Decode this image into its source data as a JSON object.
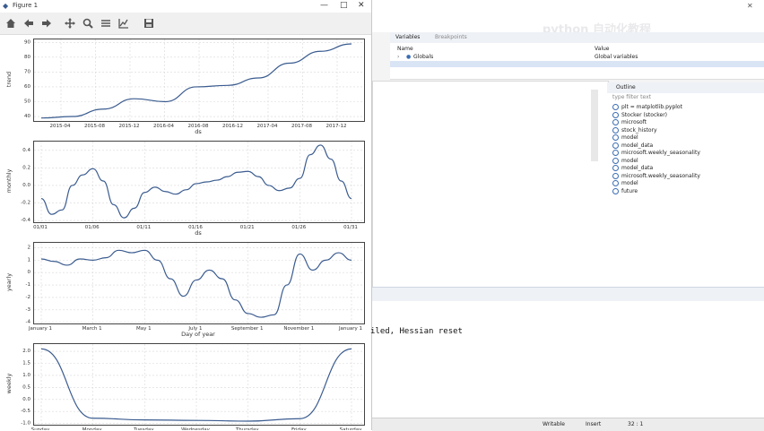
{
  "window": {
    "title": "Figure 1",
    "min": "—",
    "max": "□",
    "close": "✕"
  },
  "ide": {
    "watermark": "python 自动化教程 ",
    "variables_tab": "Variables",
    "breakpoints_tab": "Breakpoints",
    "var_col_name": "Name",
    "var_col_value": "Value",
    "globals_name": "Globals",
    "globals_value": "Global variables",
    "outline_tab": "Outline",
    "outline_filter": "type filter text",
    "outline_items": [
      "plt = matplotlib.pyplot",
      "Stocker (stocker)",
      "microsoft",
      "stock_history",
      "model",
      "model_data",
      "microsoft.weekly_seasonality",
      "model",
      "model_data",
      "microsoft.weekly_seasonality",
      "model",
      "future"
    ],
    "console_text": "iled, Hessian reset",
    "status_writable": "Writable",
    "status_insert": "Insert",
    "status_pos": "32 : 1"
  },
  "chart_data": [
    {
      "type": "line",
      "title": "",
      "xlabel": "ds",
      "ylabel": "trend",
      "grid": true,
      "x": [
        "2015-02",
        "2015-04",
        "2015-08",
        "2015-12",
        "2016-04",
        "2016-08",
        "2016-12",
        "2017-04",
        "2017-08",
        "2017-12",
        "2018-01"
      ],
      "series": [
        {
          "values": [
            39,
            40,
            45,
            52,
            50,
            60,
            61,
            66,
            76,
            84,
            89
          ]
        }
      ],
      "xticks": [
        "2015-04",
        "2015-08",
        "2015-12",
        "2016-04",
        "2016-08",
        "2016-12",
        "2017-04",
        "2017-08",
        "2017-12"
      ],
      "yticks": [
        "40",
        "50",
        "60",
        "70",
        "80",
        "90"
      ],
      "ylim": [
        37,
        92
      ]
    },
    {
      "type": "line",
      "title": "",
      "xlabel": "ds",
      "ylabel": "monthly",
      "grid": true,
      "x": [
        1,
        2,
        3,
        4,
        5,
        6,
        7,
        8,
        9,
        10,
        11,
        12,
        13,
        14,
        15,
        16,
        17,
        18,
        19,
        20,
        21,
        22,
        23,
        24,
        25,
        26,
        27,
        28,
        29,
        30,
        31
      ],
      "series": [
        {
          "values": [
            -0.15,
            -0.33,
            -0.28,
            0.0,
            0.12,
            0.19,
            0.05,
            -0.22,
            -0.37,
            -0.26,
            -0.08,
            -0.02,
            -0.07,
            -0.1,
            -0.05,
            0.02,
            0.04,
            0.06,
            0.1,
            0.15,
            0.16,
            0.1,
            0.0,
            -0.06,
            -0.03,
            0.08,
            0.35,
            0.46,
            0.3,
            0.05,
            -0.15
          ]
        }
      ],
      "xticks": [
        "01/01",
        "01/06",
        "01/11",
        "01/16",
        "01/21",
        "01/26",
        "01/31"
      ],
      "yticks": [
        "-0.4",
        "-0.2",
        "0.0",
        "0.2",
        "0.4"
      ],
      "ylim": [
        -0.42,
        0.5
      ]
    },
    {
      "type": "line",
      "title": "",
      "xlabel": "Day of year",
      "ylabel": "yearly",
      "grid": true,
      "x": [
        0,
        15,
        31,
        46,
        59,
        75,
        90,
        105,
        120,
        135,
        151,
        166,
        181,
        196,
        212,
        227,
        243,
        258,
        273,
        288,
        304,
        319,
        334,
        349,
        365
      ],
      "series": [
        {
          "values": [
            1.1,
            0.9,
            0.6,
            1.1,
            1.0,
            1.2,
            1.8,
            1.6,
            1.8,
            1.0,
            -0.5,
            -1.9,
            -0.6,
            0.2,
            -0.5,
            -2.2,
            -3.3,
            -3.6,
            -3.4,
            -1.0,
            1.5,
            0.2,
            1.0,
            1.6,
            1.0
          ]
        }
      ],
      "xticks": [
        "January 1",
        "March 1",
        "May 1",
        "July 1",
        "September 1",
        "November 1",
        "January 1"
      ],
      "yticks": [
        "-4",
        "-3",
        "-2",
        "-1",
        "0",
        "1",
        "2"
      ],
      "ylim": [
        -4.1,
        2.4
      ]
    },
    {
      "type": "line",
      "title": "",
      "xlabel": "",
      "ylabel": "weekly",
      "grid": true,
      "x": [
        "Sunday",
        "Monday",
        "Tuesday",
        "Wednesday",
        "Thursday",
        "Friday",
        "Saturday"
      ],
      "series": [
        {
          "values": [
            2.1,
            -0.78,
            -0.85,
            -0.87,
            -0.9,
            -0.8,
            2.1
          ]
        }
      ],
      "xticks": [
        "Sunday",
        "Monday",
        "Tuesday",
        "Wednesday",
        "Thursday",
        "Friday",
        "Saturday"
      ],
      "yticks": [
        "-1.0",
        "-0.5",
        "0.0",
        "0.5",
        "1.0",
        "1.5",
        "2.0"
      ],
      "ylim": [
        -1.05,
        2.3
      ]
    }
  ],
  "colors": {
    "line": "#3a5b8f",
    "grid": "#d8d8d8",
    "axis": "#333333",
    "ide_blue": "#3b6db3"
  }
}
